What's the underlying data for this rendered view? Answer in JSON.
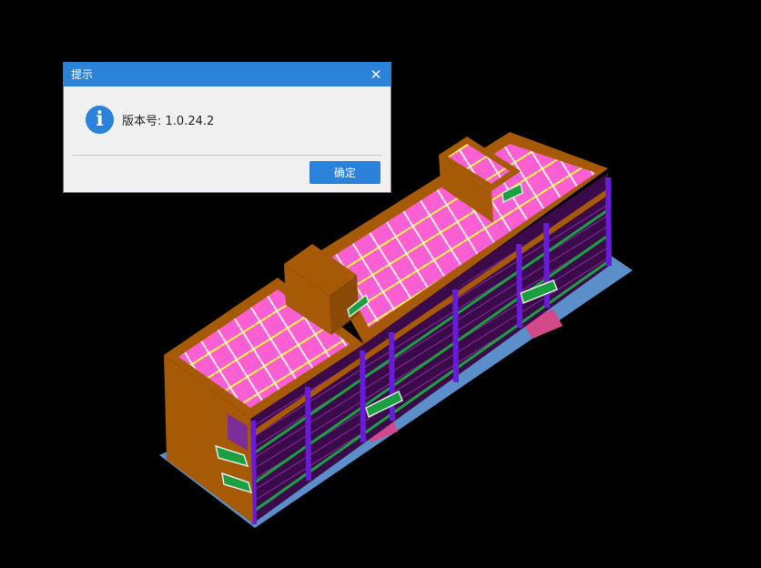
{
  "dialog": {
    "title": "提示",
    "close_glyph": "✕",
    "info_glyph": "i",
    "message": "版本号: 1.0.24.2",
    "ok_label": "确定",
    "icon": "info-icon"
  },
  "viewport": {
    "content": "3D building model",
    "colors": {
      "background": "#000000",
      "wall": "#a65a06",
      "roof_fill": "#ff66cc",
      "beam_yellow": "#ffff33",
      "beam_white": "#e6e6e6",
      "column": "#6a1bd8",
      "slab_edge": "#1aa040",
      "ground": "#5b8fc9",
      "accent": "#d24a8a"
    }
  }
}
